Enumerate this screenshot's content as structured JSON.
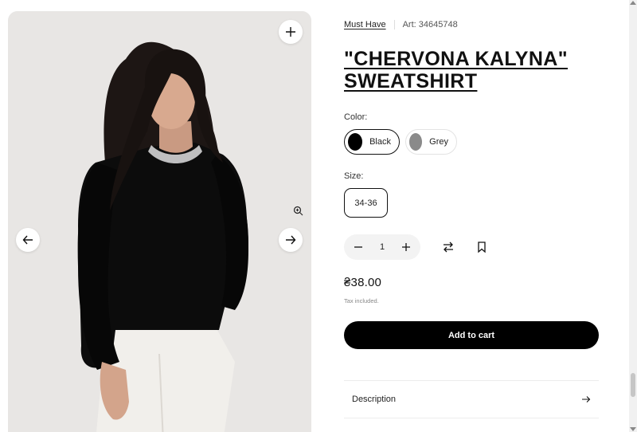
{
  "product": {
    "brand": "Must Have",
    "article": "Art: 34645748",
    "title": "\"CHERVONA KALYNA\" SWEATSHIRT",
    "color_label": "Color:",
    "colors": [
      {
        "name": "Black",
        "swatch": "#000000",
        "selected": true
      },
      {
        "name": "Grey",
        "swatch": "#8a8a8a",
        "selected": false
      }
    ],
    "size_label": "Size:",
    "sizes": [
      {
        "name": "34-36",
        "selected": true
      }
    ],
    "quantity": "1",
    "price": "₴38.00",
    "tax_note": "Tax included.",
    "add_to_cart": "Add to cart",
    "accordion": [
      {
        "label": "Description"
      }
    ]
  },
  "gallery": {
    "icons": {
      "expand": "plus-icon",
      "prev": "arrow-left-icon",
      "next": "arrow-right-icon",
      "zoom": "zoom-in-icon"
    }
  },
  "colors": {
    "accent": "#000000",
    "button_text": "#ffffff",
    "border": "#e3e3e3"
  }
}
